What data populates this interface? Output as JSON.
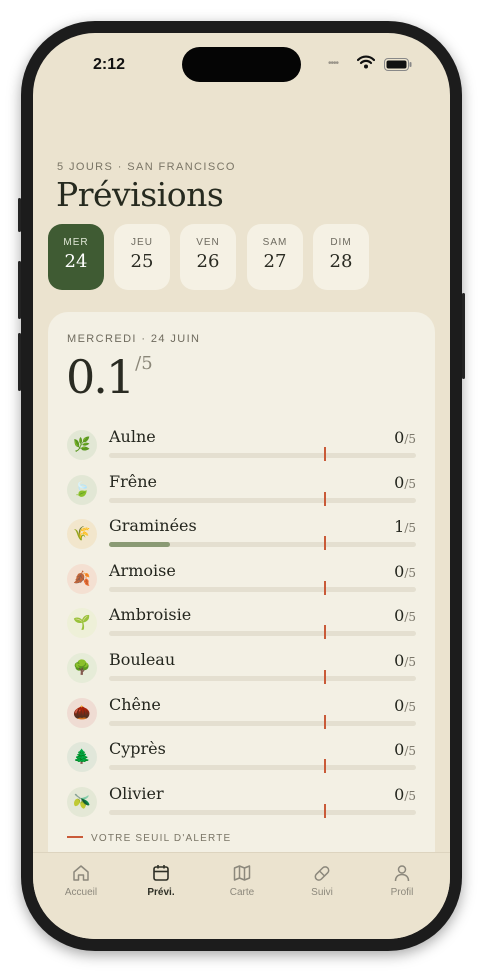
{
  "status": {
    "time": "2:12"
  },
  "header": {
    "subtitle": "5 JOURS · SAN FRANCISCO",
    "title": "Prévisions"
  },
  "days": [
    {
      "name": "MER",
      "num": "24",
      "active": true
    },
    {
      "name": "JEU",
      "num": "25",
      "active": false
    },
    {
      "name": "VEN",
      "num": "26",
      "active": false
    },
    {
      "name": "SAM",
      "num": "27",
      "active": false
    },
    {
      "name": "DIM",
      "num": "28",
      "active": false
    }
  ],
  "card": {
    "date_label": "MERCREDI · 24 JUIN",
    "score": "0.1",
    "score_denominator": "/5",
    "legend": "VOTRE SEUIL D'ALERTE",
    "threshold_value": 3.5,
    "threshold_color": "#c95a38",
    "pollens": [
      {
        "name": "Aulne",
        "value": "0",
        "level": 0,
        "icon": "leaf-icon",
        "glyph": "🌿"
      },
      {
        "name": "Frêne",
        "value": "0",
        "level": 0,
        "icon": "ash-leaf-icon",
        "glyph": "🍃"
      },
      {
        "name": "Graminées",
        "value": "1",
        "level": 1,
        "icon": "grass-icon",
        "glyph": "🌾"
      },
      {
        "name": "Armoise",
        "value": "0",
        "level": 0,
        "icon": "mugwort-icon",
        "glyph": "🍂"
      },
      {
        "name": "Ambroisie",
        "value": "0",
        "level": 0,
        "icon": "sprout-icon",
        "glyph": "🌱"
      },
      {
        "name": "Bouleau",
        "value": "0",
        "level": 0,
        "icon": "birch-tree-icon",
        "glyph": "🌳"
      },
      {
        "name": "Chêne",
        "value": "0",
        "level": 0,
        "icon": "acorn-icon",
        "glyph": "🌰"
      },
      {
        "name": "Cyprès",
        "value": "0",
        "level": 0,
        "icon": "cypress-icon",
        "glyph": "🌲"
      },
      {
        "name": "Olivier",
        "value": "0",
        "level": 0,
        "icon": "olive-icon",
        "glyph": "🫒"
      }
    ]
  },
  "tabs": [
    {
      "label": "Accueil",
      "icon": "home-icon",
      "active": false
    },
    {
      "label": "Prévi.",
      "icon": "calendar-icon",
      "active": true
    },
    {
      "label": "Carte",
      "icon": "map-icon",
      "active": false
    },
    {
      "label": "Suivi",
      "icon": "pill-icon",
      "active": false
    },
    {
      "label": "Profil",
      "icon": "profile-icon",
      "active": false
    }
  ]
}
